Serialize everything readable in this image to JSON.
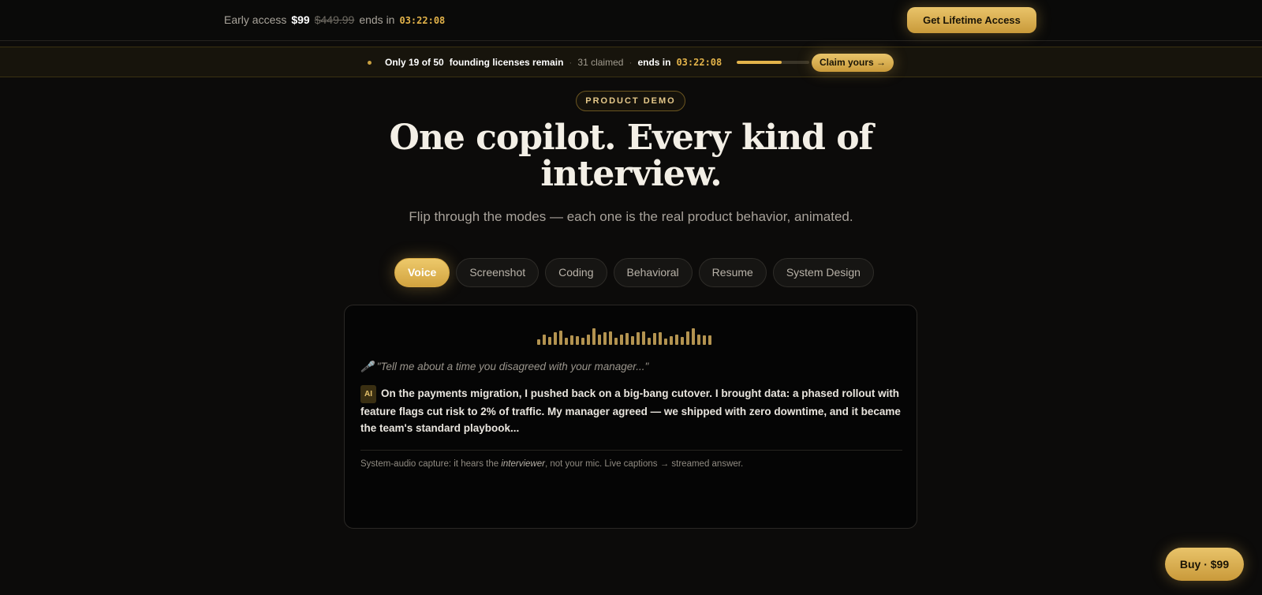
{
  "topbar": {
    "early_access_label": "Early access",
    "price": "$99",
    "original_price": "$449.99",
    "ends_label": "ends in",
    "countdown": "03:22:08",
    "cta_label": "Get Lifetime Access"
  },
  "scarcity": {
    "remaining_label": "Only 19 of 50",
    "remaining_suffix": "founding licenses remain",
    "separator": "·",
    "claimed_label": "31 claimed",
    "ends_label": "ends in",
    "countdown": "03:22:08",
    "claimed_fraction": 0.62,
    "claim_button_label": "Claim yours →"
  },
  "hero": {
    "badge": "PRODUCT DEMO",
    "title": "One copilot. Every kind of interview.",
    "subtitle": "Flip through the modes — each one is the real product behavior, animated."
  },
  "tabs": [
    {
      "label": "Voice",
      "active": true
    },
    {
      "label": "Screenshot",
      "active": false
    },
    {
      "label": "Coding",
      "active": false
    },
    {
      "label": "Behavioral",
      "active": false
    },
    {
      "label": "Resume",
      "active": false
    },
    {
      "label": "System Design",
      "active": false
    }
  ],
  "demo": {
    "waveform_levels": [
      0.2,
      0.55,
      0.35,
      0.7,
      0.8,
      0.3,
      0.45,
      0.4,
      0.3,
      0.55,
      0.95,
      0.55,
      0.7,
      0.75,
      0.3,
      0.5,
      0.65,
      0.4,
      0.7,
      0.75,
      0.3,
      0.65,
      0.7,
      0.25,
      0.4,
      0.55,
      0.35,
      0.75,
      0.95,
      0.5,
      0.45,
      0.45
    ],
    "mic_icon": "microphone-icon",
    "prompt": "\"Tell me about a time you disagreed with your manager...\"",
    "ai_tag": "AI",
    "answer": "On the payments migration, I pushed back on a big-bang cutover. I brought data: a phased rollout with feature flags cut risk to 2% of traffic. My manager agreed — we shipped with zero downtime, and it became the team's standard playbook...",
    "footnote_prefix": "System-audio capture: it hears the",
    "footnote_emphasis": "interviewer",
    "footnote_suffix": ", not your mic. Live captions → streamed answer."
  },
  "floating": {
    "buy_label": "Buy · $99"
  },
  "colors": {
    "accent_gold": "#e3b34a",
    "background": "#0c0b0a"
  }
}
